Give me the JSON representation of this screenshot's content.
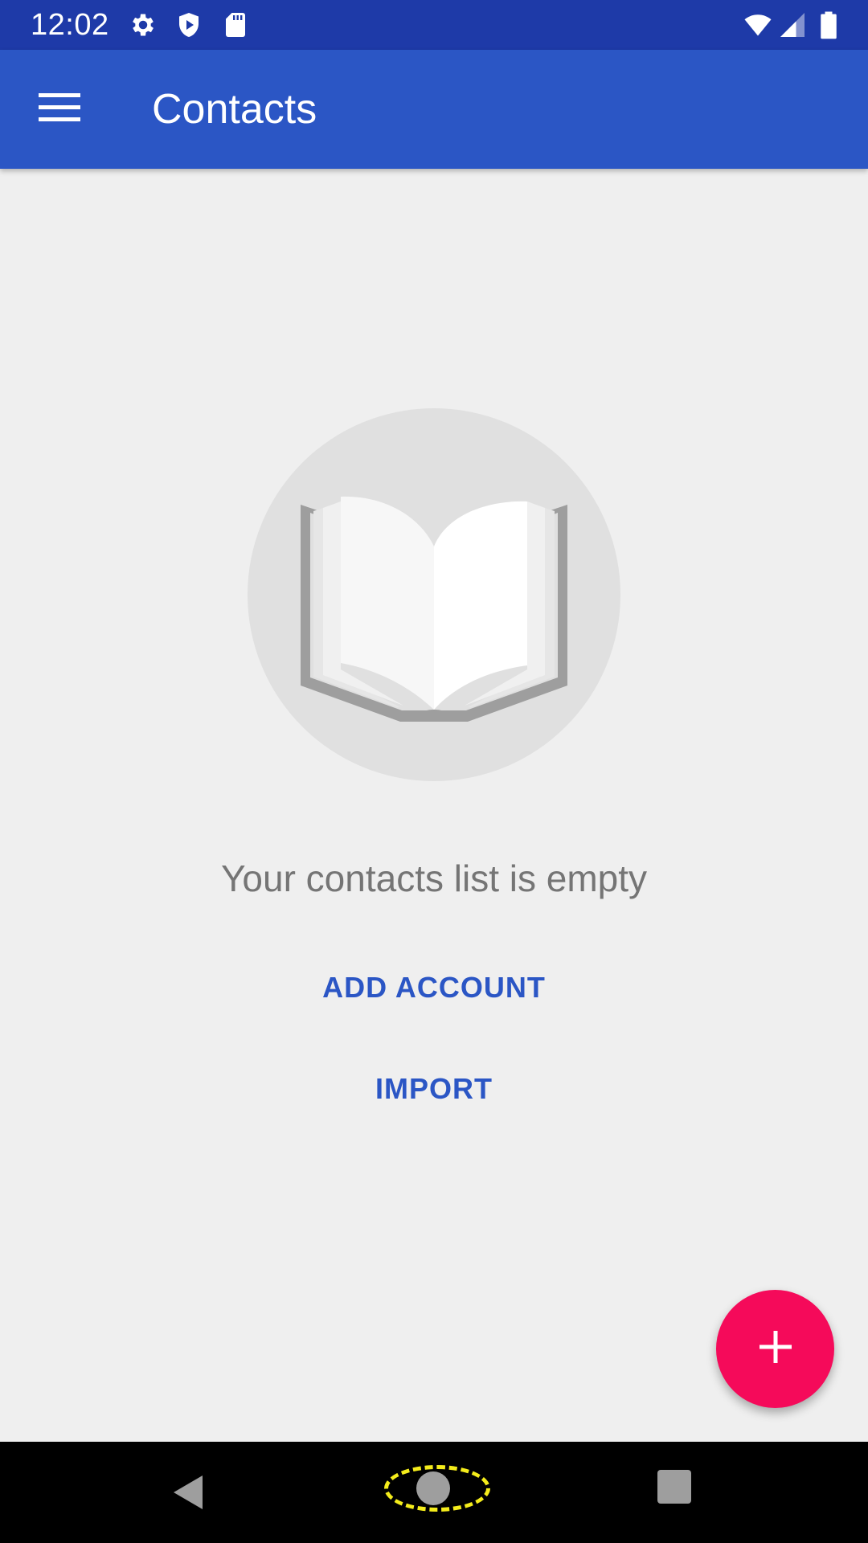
{
  "status_bar": {
    "time": "12:02",
    "left_icons": [
      "gear-icon",
      "shield-icon",
      "sd-card-icon"
    ],
    "right_icons": [
      "wifi-icon",
      "cell-signal-icon",
      "battery-icon"
    ]
  },
  "app_bar": {
    "title": "Contacts",
    "menu_icon": "hamburger-menu-icon"
  },
  "empty_state": {
    "illustration": "open-book-icon",
    "message": "Your contacts list is empty",
    "add_account_label": "ADD ACCOUNT",
    "import_label": "IMPORT"
  },
  "fab": {
    "icon": "plus-icon"
  },
  "nav_bar": {
    "back_icon": "back-triangle-icon",
    "home_icon": "home-circle-icon",
    "recents_icon": "recents-square-icon"
  },
  "colors": {
    "status_bar": "#1e3aa8",
    "app_bar": "#2b56c5",
    "background": "#efefef",
    "accent": "#2b56c5",
    "fab": "#f50a5a",
    "nav_bar": "#000000",
    "highlight": "#f4ec1b"
  }
}
